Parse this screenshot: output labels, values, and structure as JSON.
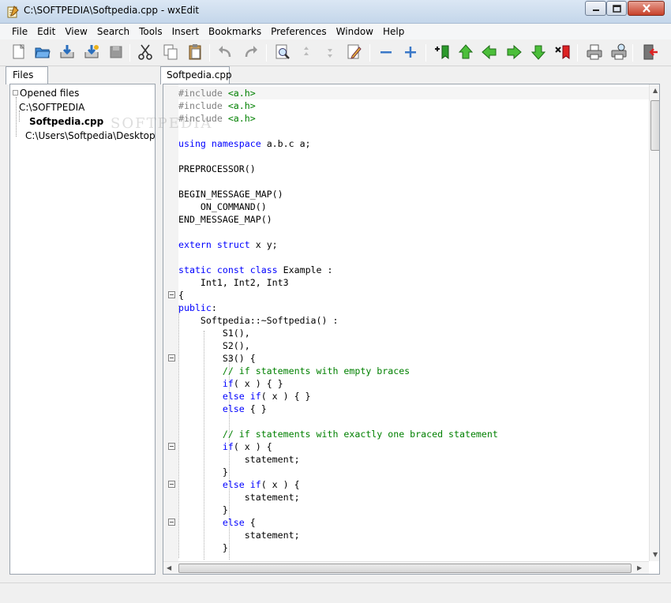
{
  "window": {
    "title": "C:\\SOFTPEDIA\\Softpedia.cpp - wxEdit"
  },
  "menu": [
    "File",
    "Edit",
    "View",
    "Search",
    "Tools",
    "Insert",
    "Bookmarks",
    "Preferences",
    "Window",
    "Help"
  ],
  "toolbar_icons": [
    "new-file-icon",
    "open-file-icon",
    "save-icon",
    "save-as-icon",
    "save-all-icon",
    "cut-icon",
    "copy-icon",
    "paste-icon",
    "undo-icon",
    "redo-icon",
    "find-icon",
    "find-prev-icon",
    "find-next-icon",
    "replace-icon",
    "zoom-out-icon",
    "zoom-in-icon",
    "add-bookmark-icon",
    "bookmark-first-icon",
    "bookmark-prev-icon",
    "bookmark-next-icon",
    "bookmark-last-icon",
    "remove-bookmark-icon",
    "print-icon",
    "print-preview-icon",
    "exit-icon"
  ],
  "files_panel": {
    "tab_label": "Files",
    "root": "Opened files",
    "folders": [
      {
        "path": "C:\\SOFTPEDIA",
        "files": [
          "Softpedia.cpp"
        ]
      },
      {
        "path": "C:\\Users\\Softpedia\\Desktop",
        "files": []
      }
    ]
  },
  "editor": {
    "tab_label": "Softpedia.cpp",
    "watermark": "SOFTPEDIA",
    "lines": [
      "#include <a.h>",
      "#include <a.h>",
      "#include <a.h>",
      "",
      "using namespace a.b.c a;",
      "",
      "PREPROCESSOR()",
      "",
      "BEGIN_MESSAGE_MAP()",
      "    ON_COMMAND()",
      "END_MESSAGE_MAP()",
      "",
      "extern struct x y;",
      "",
      "static const class Example :",
      "    Int1, Int2, Int3",
      "{",
      "public:",
      "    Softpedia::~Softpedia() :",
      "        S1(),",
      "        S2(),",
      "        S3() {",
      "        // if statements with empty braces",
      "        if( x ) { }",
      "        else if( x ) { }",
      "        else { }",
      "",
      "        // if statements with exactly one braced statement",
      "        if( x ) {",
      "            statement;",
      "        }",
      "        else if( x ) {",
      "            statement;",
      "        }",
      "        else {",
      "            statement;",
      "        }"
    ]
  }
}
